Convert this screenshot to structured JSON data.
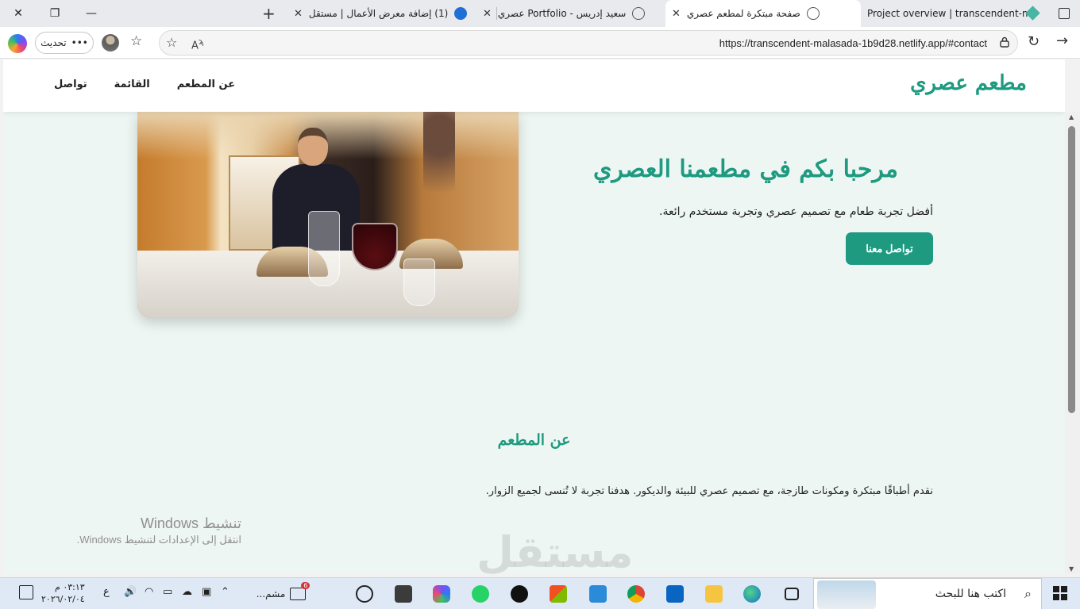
{
  "browser": {
    "tabs": [
      {
        "title": "Project overview | transcendent-m",
        "active": false
      },
      {
        "title": "صفحة مبتكرة لمطعم عصري",
        "active": true
      },
      {
        "title": "سعيد إدريس - Portfolio عصري",
        "active": false
      },
      {
        "title": "(1) إضافة معرض الأعمال | مستقل",
        "active": false
      }
    ],
    "update_label": "تحديث",
    "url": "https://transcendent-malasada-1b9d28.netlify.app/#contact"
  },
  "site": {
    "logo": "مطعم عصري",
    "nav": [
      "عن المطعم",
      "القائمة",
      "تواصل"
    ],
    "hero": {
      "title": "مرحبا بكم في مطعمنا العصري",
      "subtitle": "أفضل تجربة طعام مع تصميم عصري وتجربة مستخدم رائعة.",
      "button": "تواصل معنا"
    },
    "about": {
      "title": "عن المطعم",
      "text": "نقدم أطباقًا مبتكرة ومكونات طازجة، مع تصميم عصري للبيئة والديكور. هدفنا تجربة لا تُنسى لجميع الزوار."
    }
  },
  "overlay": {
    "activate_title": "تنشيط Windows",
    "activate_sub": "انتقل إلى الإعدادات لتنشيط Windows.",
    "watermark": "مستقل"
  },
  "taskbar": {
    "search_placeholder": "اكتب هنا للبحث",
    "pinned_label": "مشم...",
    "keyboard_lang": "ع",
    "time": "٠٣:١٣ م",
    "date": "٢٠٢٦/٠٢/٠٤",
    "badge_count": "6"
  },
  "colors": {
    "accent": "#1d9a80",
    "page_bg": "#eef6f3"
  }
}
